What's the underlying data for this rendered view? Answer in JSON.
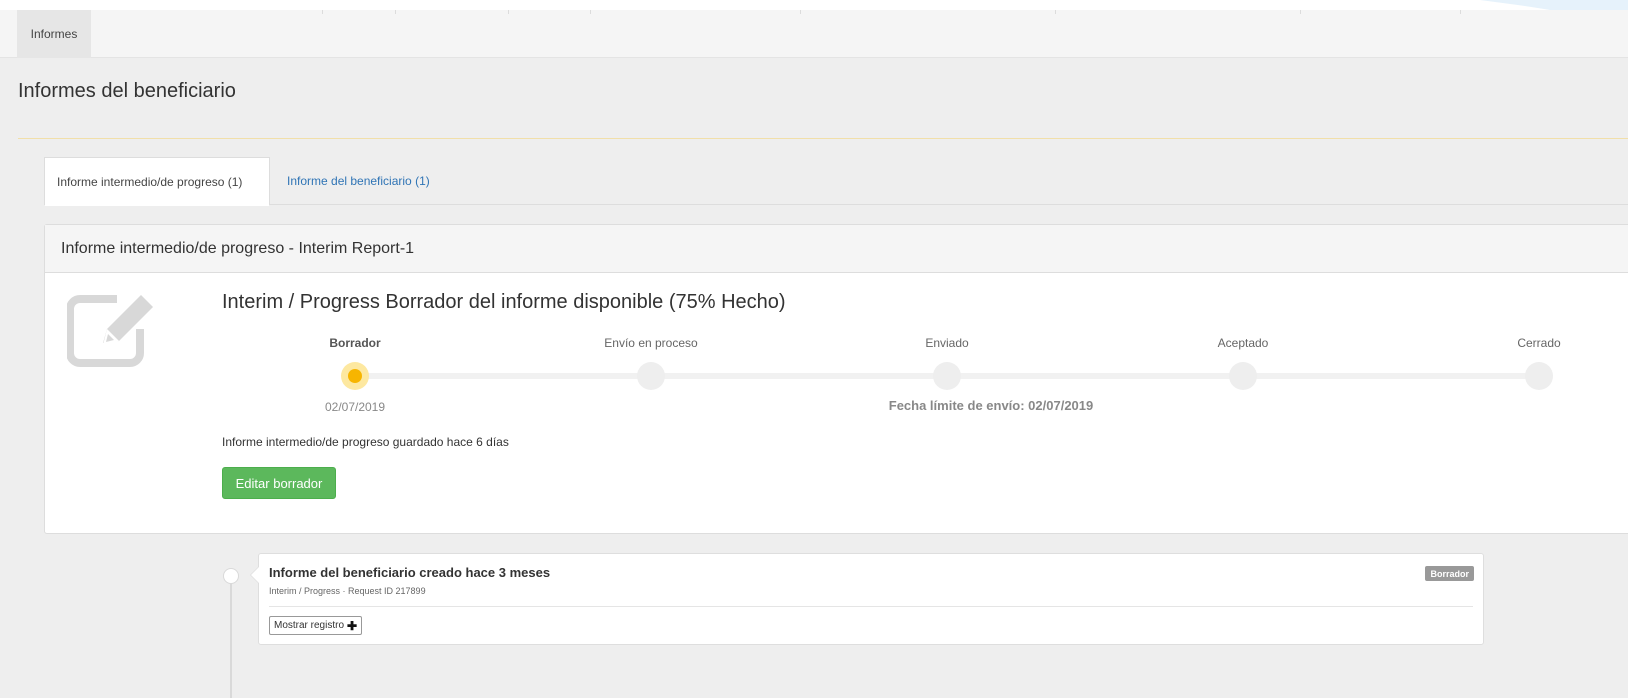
{
  "breadcrumb": {
    "item": "Informes"
  },
  "page": {
    "title": "Informes del beneficiario"
  },
  "tabs": [
    {
      "label": "Informe intermedio/de progreso (1)",
      "active": true
    },
    {
      "label": "Informe del beneficiario (1)",
      "active": false
    }
  ],
  "panel": {
    "heading": "Informe intermedio/de progreso - Interim Report-1",
    "icon": "edit-document-icon",
    "report_title": "Interim / Progress Borrador del informe disponible (75% Hecho)",
    "progress_percent": 75,
    "steps": [
      {
        "label": "Borrador",
        "current": true,
        "date": "02/07/2019"
      },
      {
        "label": "Envío en proceso",
        "current": false
      },
      {
        "label": "Enviado",
        "current": false
      },
      {
        "label": "Aceptado",
        "current": false
      },
      {
        "label": "Cerrado",
        "current": false
      }
    ],
    "deadline": "Fecha límite de envío: 02/07/2019",
    "saved_note": "Informe intermedio/de progreso guardado hace 6 días",
    "edit_button": "Editar borrador"
  },
  "timeline": {
    "entry": {
      "title": "Informe del beneficiario creado hace 3 meses",
      "subtitle": "Interim / Progress · Request ID 217899",
      "badge": "Borrador",
      "show_button": "Mostrar registro",
      "show_icon": "plus-icon"
    }
  },
  "colors": {
    "accent_green": "#5cb85c",
    "current_step": "#f7b500",
    "link_blue": "#2f74b5",
    "badge_gray": "#999999"
  }
}
